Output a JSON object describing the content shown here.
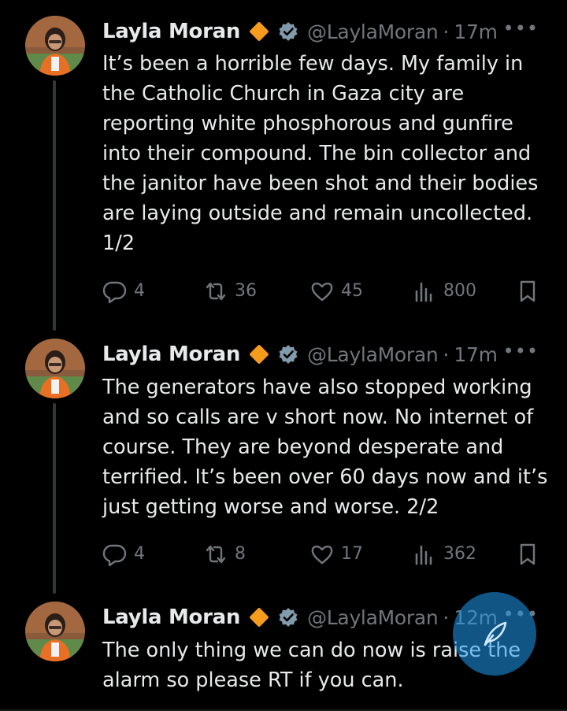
{
  "tweets": [
    {
      "name": "Layla Moran",
      "handle": "@LaylaMoran",
      "separator": "·",
      "time": "17m",
      "text": "It’s been a horrible few days. My family in\nthe Catholic Church in Gaza city are\nreporting white phosphorous and gunfire\ninto their compound. The bin collector and\nthe janitor have been shot and their bodies\nare laying outside and remain uncollected.\n1/2",
      "replies": "4",
      "reposts": "36",
      "likes": "45",
      "views": "800"
    },
    {
      "name": "Layla Moran",
      "handle": "@LaylaMoran",
      "separator": "·",
      "time": "17m",
      "text": "The generators have also stopped working\nand so calls are v short now. No internet of\ncourse. They are beyond desperate and\nterrified. It’s been over 60 days now and it’s\njust getting worse and worse. 2/2",
      "replies": "4",
      "reposts": "8",
      "likes": "17",
      "views": "362"
    },
    {
      "name": "Layla Moran",
      "handle": "@LaylaMoran",
      "separator": "·",
      "time": "12m",
      "text": "The only thing we can do now is raise the\nalarm so please RT if you can."
    }
  ],
  "more_glyph": "•••",
  "icons": {
    "reply": "reply-icon",
    "repost": "repost-icon",
    "like": "like-icon",
    "views": "views-icon",
    "bookmark": "bookmark-icon",
    "compose": "compose-icon",
    "gold_badge": "gold-badge-icon",
    "verified": "verified-icon"
  },
  "colors": {
    "background": "#000000",
    "text": "#e7e9ea",
    "muted": "#71767b",
    "gold_badge": "#f59b1e",
    "verified_badge": "#829aab",
    "fab": "#1d9bf0"
  }
}
